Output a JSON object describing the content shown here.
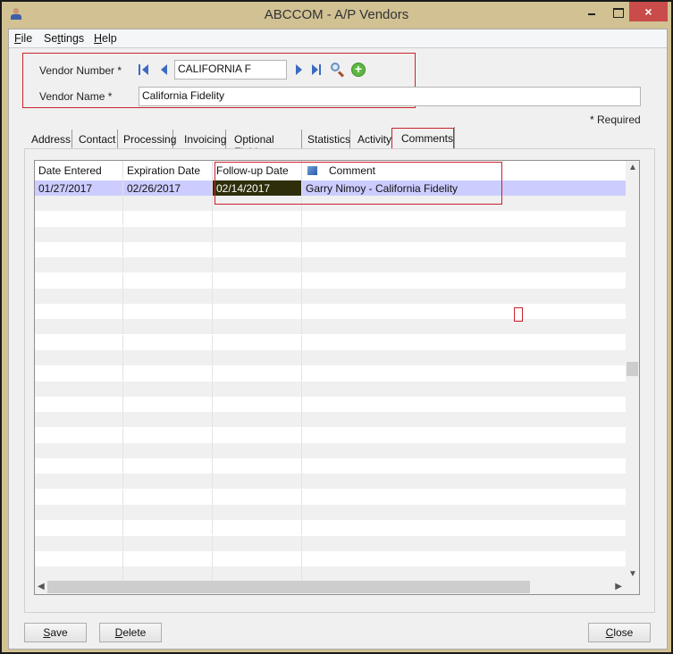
{
  "window": {
    "title": "ABCCOM - A/P Vendors",
    "controls": {
      "minimize": "minimize",
      "maximize": "maximize",
      "close": "×"
    }
  },
  "menu": [
    {
      "label": "File",
      "accel": "F",
      "rest": "ile"
    },
    {
      "label": "Settings",
      "pre": "Se",
      "accel": "t",
      "rest": "tings"
    },
    {
      "label": "Help",
      "accel": "H",
      "rest": "elp"
    }
  ],
  "header": {
    "vendor_number_label": "Vendor Number *",
    "vendor_number_value": "CALIFORNIA F",
    "vendor_name_label": "Vendor Name *",
    "vendor_name_value": "California Fidelity",
    "required_note": "* Required"
  },
  "tabs": [
    {
      "label": "Address",
      "active": false
    },
    {
      "label": "Contact",
      "active": false
    },
    {
      "label": "Processing",
      "active": false
    },
    {
      "label": "Invoicing",
      "active": false
    },
    {
      "label": "Optional Fields",
      "active": false
    },
    {
      "label": "Statistics",
      "active": false
    },
    {
      "label": "Activity",
      "active": false
    },
    {
      "label": "Comments",
      "active": true
    }
  ],
  "grid": {
    "columns": [
      "Date Entered",
      "Expiration Date",
      "Follow-up Date",
      "Comment"
    ],
    "rows": [
      {
        "date_entered": "01/27/2017",
        "expiration_date": "02/26/2017",
        "followup_date": "02/14/2017",
        "comment": "Garry Nimoy - California Fidelity"
      }
    ],
    "selected_row_color": "#ccccff",
    "focused_cell_color": "#2e2e0a"
  },
  "buttons": {
    "save": "Save",
    "delete": "Delete",
    "close": "Close"
  },
  "annotation_color": "#c8232c"
}
